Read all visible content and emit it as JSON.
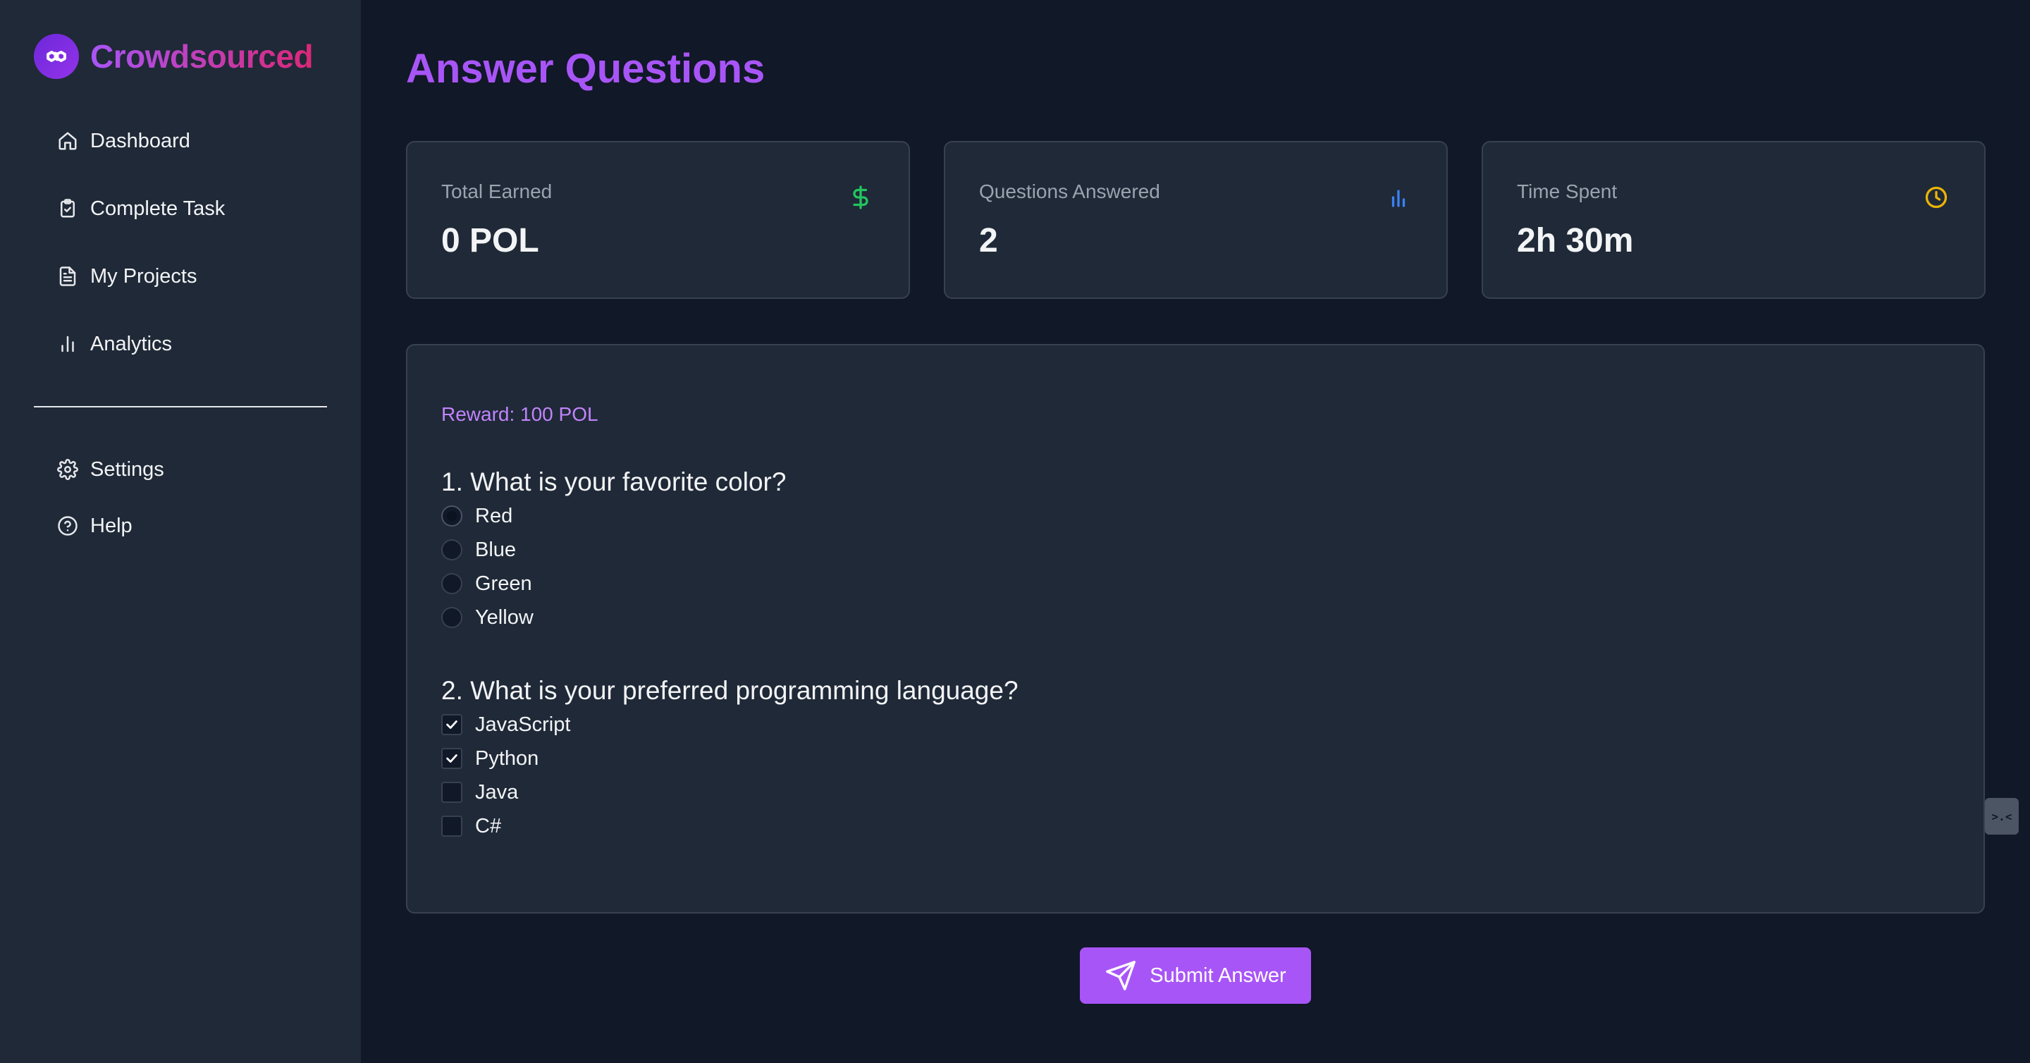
{
  "brand": {
    "name": "Crowdsourced",
    "icon": "polygon-link-icon"
  },
  "sidebar": {
    "items": [
      {
        "label": "Dashboard",
        "icon": "home-icon"
      },
      {
        "label": "Complete Task",
        "icon": "clipboard-check-icon"
      },
      {
        "label": "My Projects",
        "icon": "document-icon"
      },
      {
        "label": "Analytics",
        "icon": "bar-chart-icon"
      }
    ],
    "bottom_items": [
      {
        "label": "Settings",
        "icon": "gear-icon"
      },
      {
        "label": "Help",
        "icon": "help-circle-icon"
      }
    ]
  },
  "page": {
    "title": "Answer Questions"
  },
  "stats": [
    {
      "label": "Total Earned",
      "value": "0 POL",
      "icon": "dollar-icon",
      "color": "#22c55e"
    },
    {
      "label": "Questions Answered",
      "value": "2",
      "icon": "bar-chart-icon",
      "color": "#3b82f6"
    },
    {
      "label": "Time Spent",
      "value": "2h 30m",
      "icon": "clock-icon",
      "color": "#eab308"
    }
  ],
  "task": {
    "reward": "Reward: 100 POL",
    "questions": [
      {
        "title": "1. What is your favorite color?",
        "type": "radio",
        "options": [
          {
            "label": "Red",
            "selected": true
          },
          {
            "label": "Blue",
            "selected": false
          },
          {
            "label": "Green",
            "selected": false
          },
          {
            "label": "Yellow",
            "selected": false
          }
        ]
      },
      {
        "title": "2. What is your preferred programming language?",
        "type": "checkbox",
        "options": [
          {
            "label": "JavaScript",
            "selected": true
          },
          {
            "label": "Python",
            "selected": true
          },
          {
            "label": "Java",
            "selected": false
          },
          {
            "label": "C#",
            "selected": false
          }
        ]
      }
    ]
  },
  "actions": {
    "submit_label": "Submit Answer",
    "submit_icon": "send-icon"
  },
  "colors": {
    "accent": "#a855f7",
    "background": "#111827",
    "surface": "#1f2937"
  }
}
